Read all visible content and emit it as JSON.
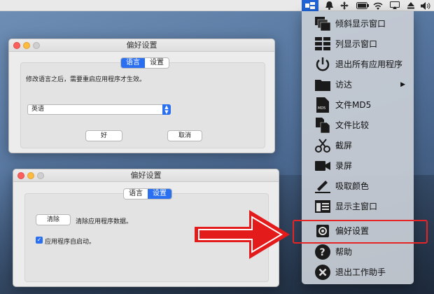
{
  "colors": {
    "accent": "#2a6ff0",
    "annotation": "#e52525",
    "menubar_active": "#1f63d6"
  },
  "menubar": {
    "icons": [
      "app-icon",
      "bell-icon",
      "move-icon",
      "battery-icon",
      "wifi-icon",
      "airplay-icon",
      "eject-icon",
      "volume-icon"
    ]
  },
  "window1": {
    "title": "偏好设置",
    "tabs": [
      "语言",
      "设置"
    ],
    "active_tab": "语言",
    "notice": "修改语言之后，需要重启应用程序才生效。",
    "language_select": "英语",
    "ok_button": "好",
    "cancel_button": "取消"
  },
  "window2": {
    "title": "偏好设置",
    "tabs": [
      "语言",
      "设置"
    ],
    "active_tab": "设置",
    "clear_button": "清除",
    "clear_desc": "清除应用程序数据。",
    "autostart_label": "应用程序自启动。",
    "autostart_checked": true
  },
  "menu": {
    "items": [
      {
        "label": "倾斜显示窗口",
        "icon": "tilted-windows-icon"
      },
      {
        "label": "列显示窗口",
        "icon": "column-windows-icon"
      },
      {
        "label": "退出所有应用程序",
        "icon": "power-icon"
      },
      {
        "label": "访达",
        "icon": "folder-icon",
        "submenu": true
      },
      {
        "label": "文件MD5",
        "icon": "md5-file-icon"
      },
      {
        "label": "文件比较",
        "icon": "compare-files-icon"
      },
      {
        "label": "截屏",
        "icon": "scissors-icon"
      },
      {
        "label": "录屏",
        "icon": "video-camera-icon"
      },
      {
        "label": "吸取颜色",
        "icon": "eyedropper-icon"
      },
      {
        "label": "显示主窗口",
        "icon": "main-window-icon"
      },
      {
        "label": "偏好设置",
        "icon": "gear-icon",
        "highlighted": true
      },
      {
        "label": "帮助",
        "icon": "help-icon"
      },
      {
        "label": "退出工作助手",
        "icon": "quit-icon"
      }
    ],
    "submenu_arrow": "▶"
  }
}
